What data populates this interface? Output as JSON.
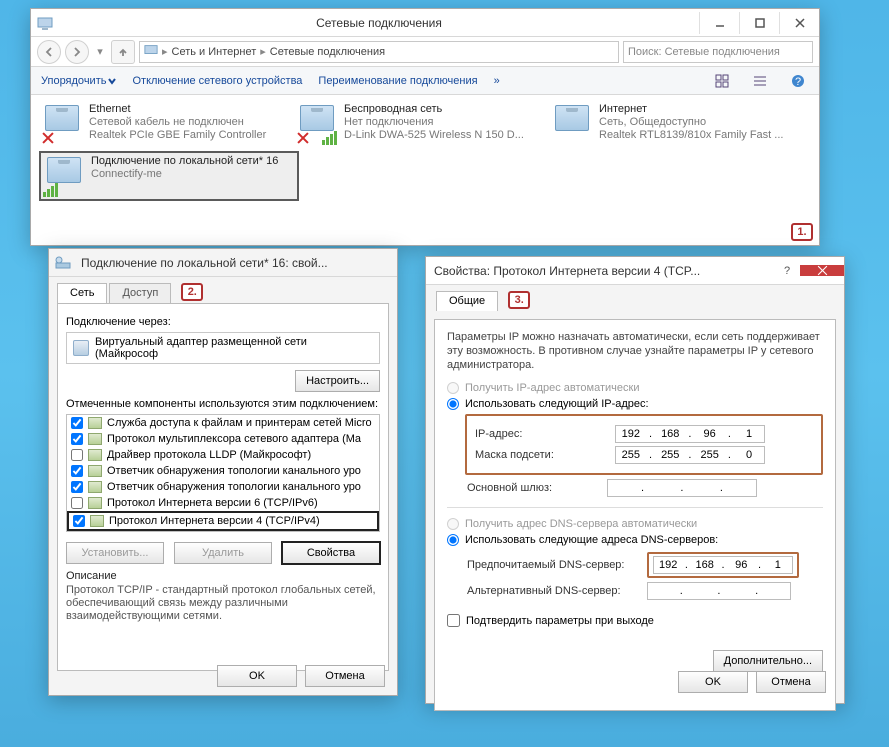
{
  "explorer": {
    "title": "Сетевые подключения",
    "breadcrumb": {
      "seg1": "Сеть и Интернет",
      "seg2": "Сетевые подключения"
    },
    "search_placeholder": "Поиск: Сетевые подключения",
    "toolbar": {
      "organize": "Упорядочить",
      "disconnect": "Отключение сетевого устройства",
      "rename": "Переименование подключения"
    },
    "connections": [
      {
        "name": "Ethernet",
        "status": "Сетевой кабель не подключен",
        "adapter": "Realtek PCIe GBE Family Controller",
        "icon": "wired-x"
      },
      {
        "name": "Беспроводная сеть",
        "status": "Нет подключения",
        "adapter": "D-Link DWA-525 Wireless N 150 D...",
        "icon": "wifi-x"
      },
      {
        "name": "Интернет",
        "status": "Сеть, Общедоступно",
        "adapter": "Realtek RTL8139/810x Family Fast ...",
        "icon": "wired"
      },
      {
        "name": "Подключение по локальной сети* 16",
        "status": "",
        "adapter": "Connectify-me",
        "icon": "wifi",
        "selected": true
      }
    ],
    "callout1": "1."
  },
  "props": {
    "title": "Подключение по локальной сети* 16: свой...",
    "tabs": {
      "net": "Сеть",
      "access": "Доступ"
    },
    "callout2": "2.",
    "conn_through_label": "Подключение через:",
    "adapter": "Виртуальный адаптер размещенной сети (Майкрософ",
    "configure": "Настроить...",
    "components_label": "Отмеченные компоненты используются этим подключением:",
    "components": [
      {
        "checked": true,
        "text": "Служба доступа к файлам и принтерам сетей Micro"
      },
      {
        "checked": true,
        "text": "Протокол мультиплексора сетевого адаптера (Ma"
      },
      {
        "checked": false,
        "text": "Драйвер протокола LLDP (Майкрософт)"
      },
      {
        "checked": true,
        "text": "Ответчик обнаружения топологии канального уро"
      },
      {
        "checked": true,
        "text": "Ответчик обнаружения топологии канального уро"
      },
      {
        "checked": false,
        "text": "Протокол Интернета версии 6 (TCP/IPv6)"
      },
      {
        "checked": true,
        "text": "Протокол Интернета версии 4 (TCP/IPv4)",
        "selected": true
      }
    ],
    "install": "Установить...",
    "remove": "Удалить",
    "properties": "Свойства",
    "desc_label": "Описание",
    "desc_text": "Протокол TCP/IP - стандартный протокол глобальных сетей, обеспечивающий связь между различными взаимодействующими сетями.",
    "ok": "OK",
    "cancel": "Отмена"
  },
  "ipv4": {
    "title": "Свойства: Протокол Интернета версии 4 (TCP...",
    "tab_general": "Общие",
    "callout3": "3.",
    "intro": "Параметры IP можно назначать автоматически, если сеть поддерживает эту возможность. В противном случае узнайте параметры IP у сетевого администратора.",
    "auto_ip": "Получить IP-адрес автоматически",
    "use_ip": "Использовать следующий IP-адрес:",
    "ip_label": "IP-адрес:",
    "ip": [
      "192",
      "168",
      "96",
      "1"
    ],
    "mask_label": "Маска подсети:",
    "mask": [
      "255",
      "255",
      "255",
      "0"
    ],
    "gw_label": "Основной шлюз:",
    "gw": [
      "",
      "",
      "",
      ""
    ],
    "auto_dns": "Получить адрес DNS-сервера автоматически",
    "use_dns": "Использовать следующие адреса DNS-серверов:",
    "pref_dns_label": "Предпочитаемый DNS-сервер:",
    "pref_dns": [
      "192",
      "168",
      "96",
      "1"
    ],
    "alt_dns_label": "Альтернативный DNS-сервер:",
    "alt_dns": [
      "",
      "",
      "",
      ""
    ],
    "confirm_exit": "Подтвердить параметры при выходе",
    "advanced": "Дополнительно...",
    "ok": "OK",
    "cancel": "Отмена"
  }
}
